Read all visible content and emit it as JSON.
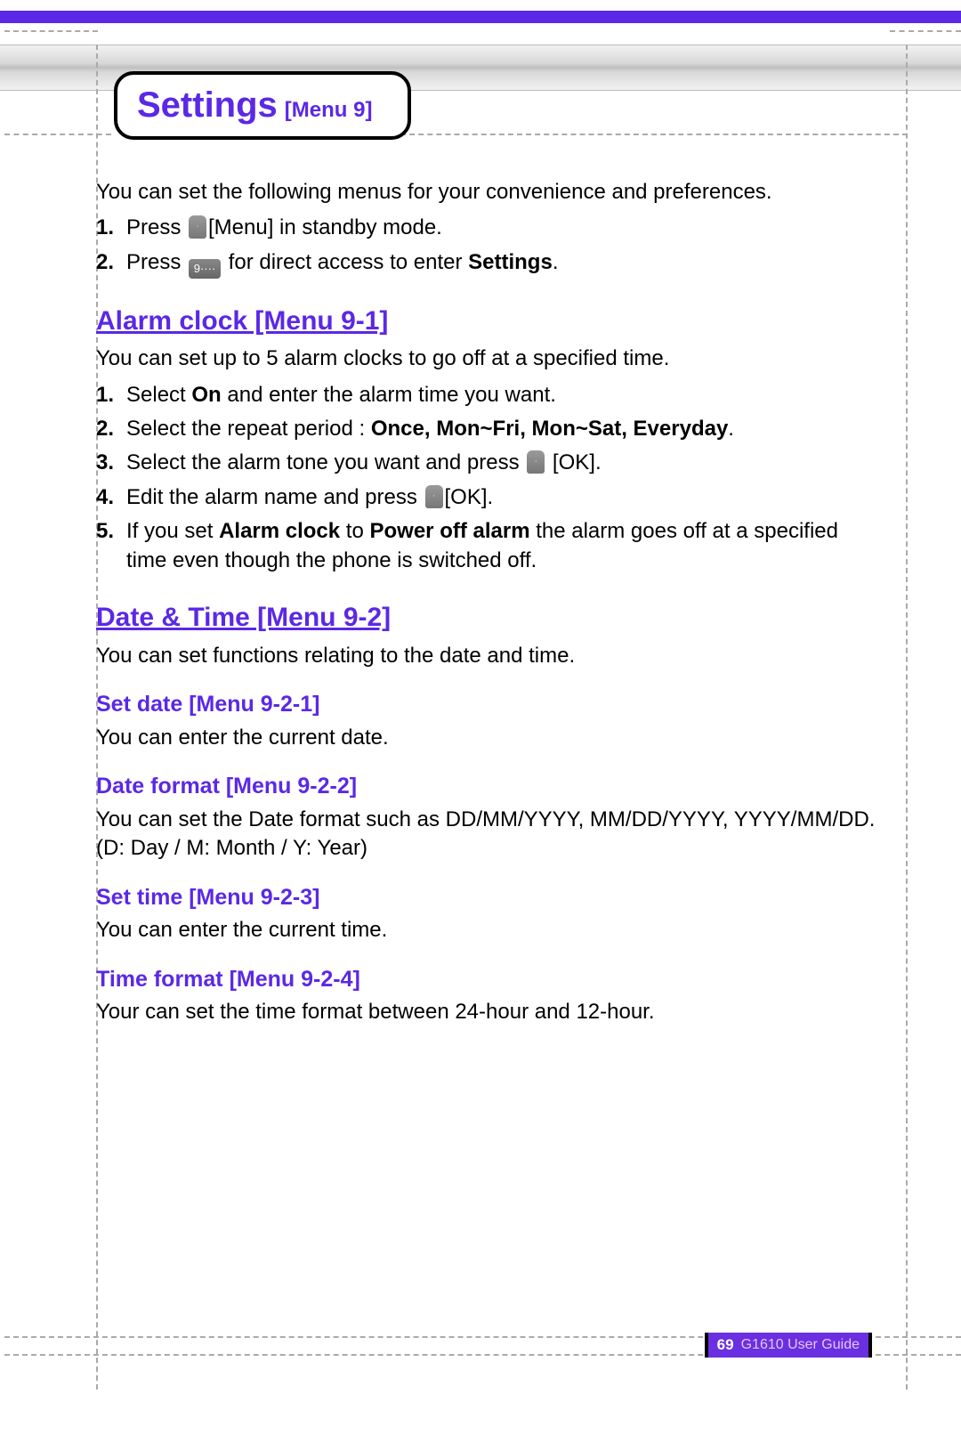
{
  "header": {
    "title": "Settings",
    "subtitle": "[Menu 9]"
  },
  "intro": "You can set the following menus for your convenience and preferences.",
  "intro_steps": [
    {
      "num": "1.",
      "pre": "Press ",
      "icon": "key",
      "post": "[Menu] in standby mode."
    },
    {
      "num": "2.",
      "pre": "Press ",
      "icon": "nine",
      "post_pre": " for direct access to enter ",
      "post_bold": "Settings",
      "post_suf": "."
    }
  ],
  "sections": {
    "alarm": {
      "heading": "Alarm clock [Menu 9-1]",
      "desc": "You can set up to 5 alarm clocks to go off at a specified time.",
      "steps": [
        {
          "num": "1.",
          "parts": [
            "Select ",
            {
              "b": "On"
            },
            " and enter the alarm time you want."
          ]
        },
        {
          "num": "2.",
          "parts": [
            "Select the repeat period : ",
            {
              "b": "Once, Mon~Fri, Mon~Sat, Everyday"
            },
            "."
          ]
        },
        {
          "num": "3.",
          "parts": [
            "Select the alarm tone you want and press ",
            {
              "icon": "key"
            },
            " [OK]."
          ]
        },
        {
          "num": "4.",
          "parts": [
            "Edit the alarm name and press ",
            {
              "icon": "key"
            },
            "[OK]."
          ]
        },
        {
          "num": "5.",
          "parts": [
            "If you set ",
            {
              "b": "Alarm clock"
            },
            " to ",
            {
              "b": "Power off alarm"
            },
            " the alarm goes off at a specified time even though the phone is switched off."
          ]
        }
      ]
    },
    "datetime": {
      "heading": "Date & Time [Menu 9-2]",
      "desc": "You can set functions relating to the date and time.",
      "subs": [
        {
          "heading": "Set date [Menu 9-2-1]",
          "desc": "You can enter the current date."
        },
        {
          "heading": "Date format [Menu 9-2-2]",
          "desc": "You can set the Date format such as DD/MM/YYYY, MM/DD/YYYY, YYYY/MM/DD. (D: Day / M: Month / Y: Year)"
        },
        {
          "heading": "Set time [Menu 9-2-3]",
          "desc": "You can enter the current time."
        },
        {
          "heading": "Time format [Menu 9-2-4]",
          "desc": "Your can set the time format between 24-hour and 12-hour."
        }
      ]
    }
  },
  "footer": {
    "page": "69",
    "guide": "G1610 User Guide"
  }
}
